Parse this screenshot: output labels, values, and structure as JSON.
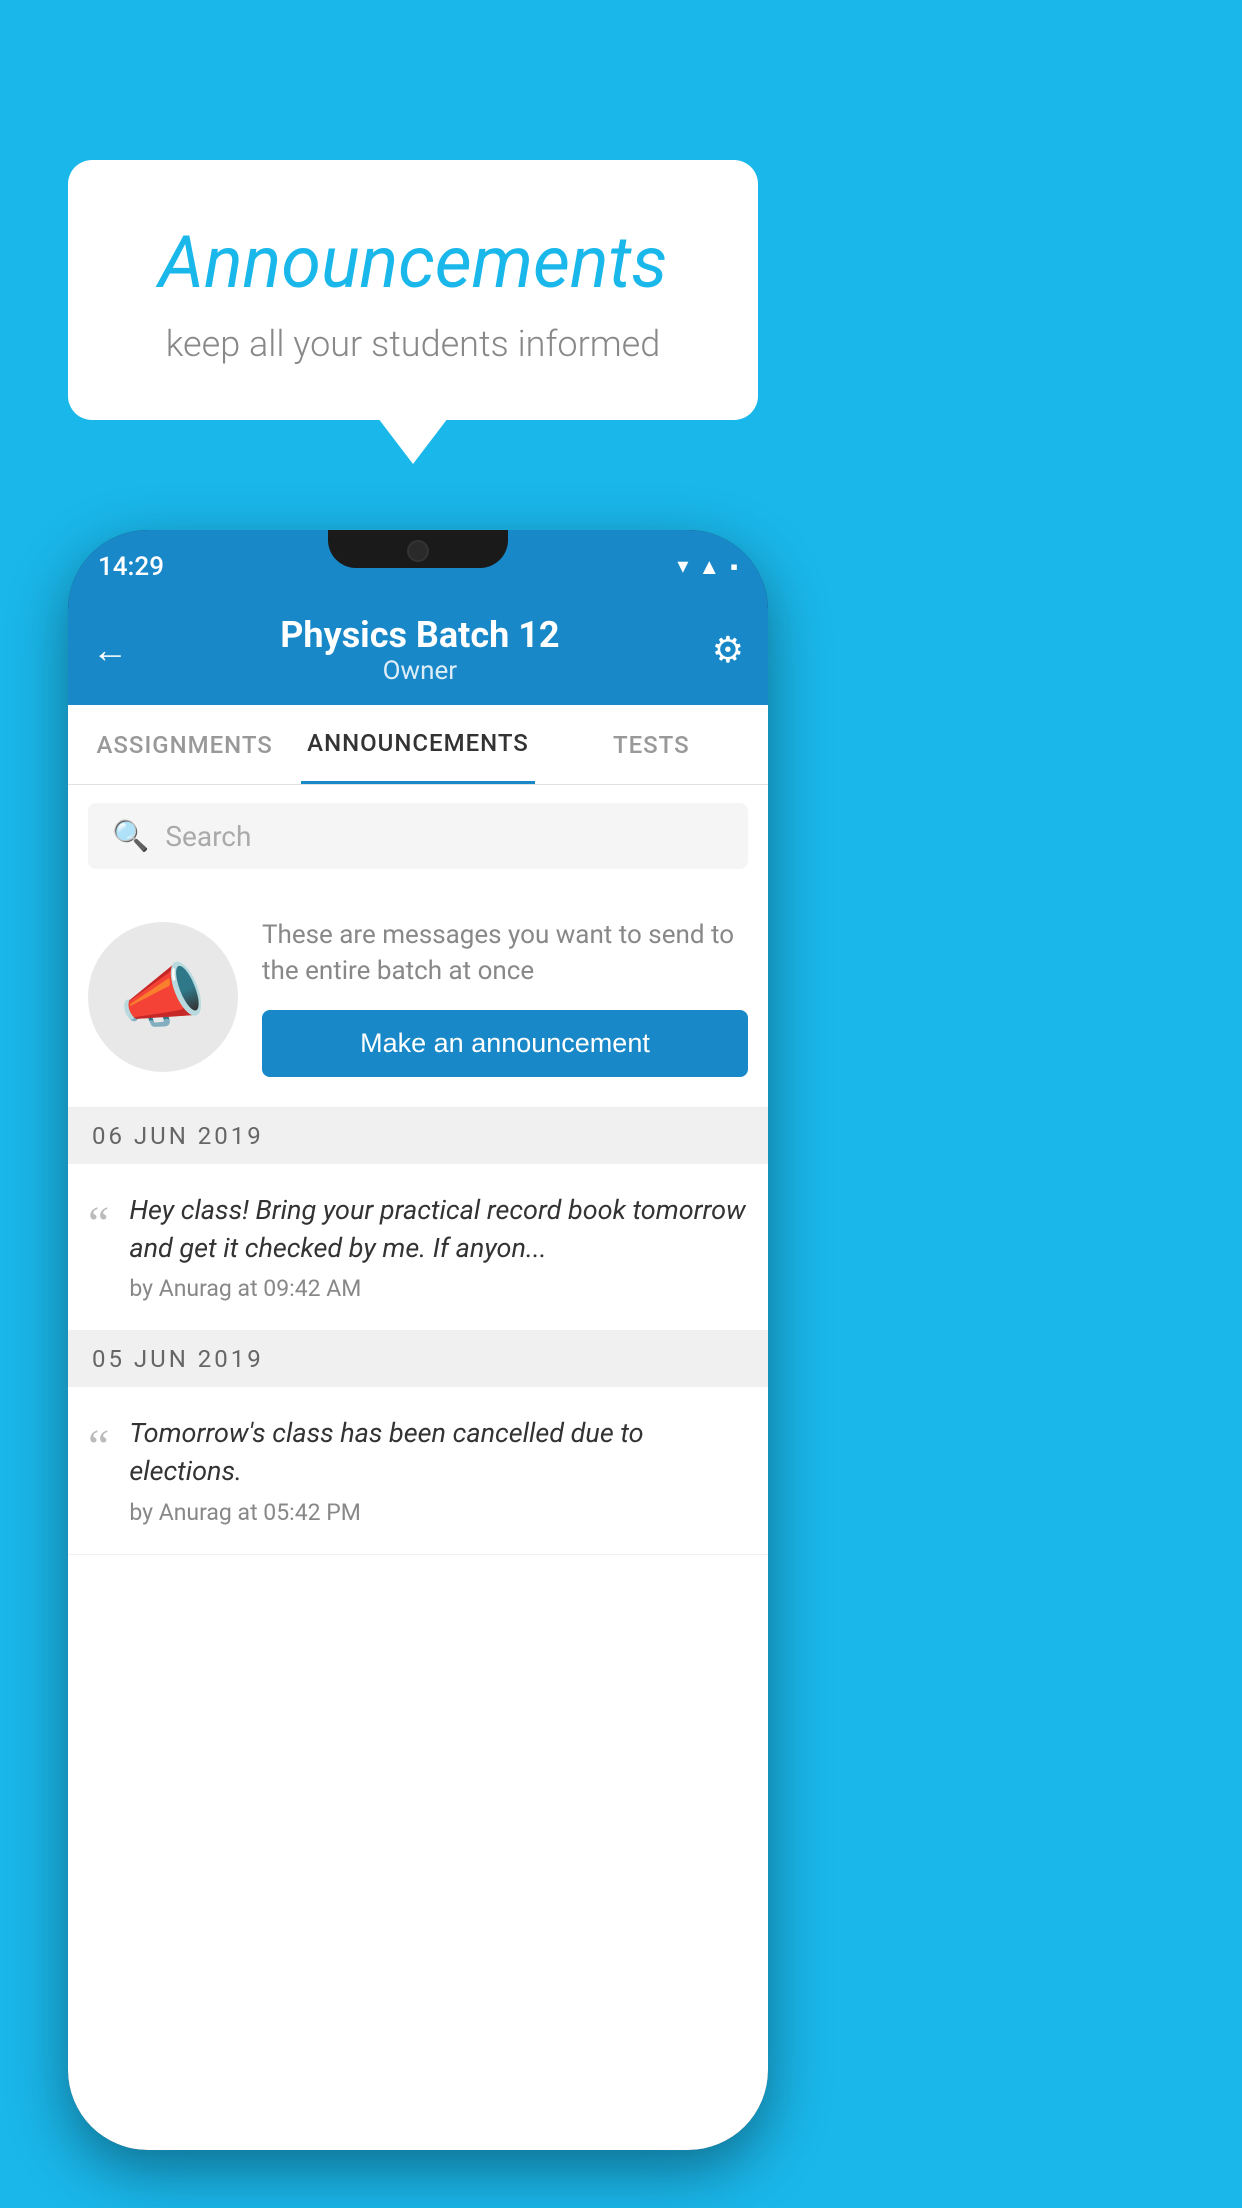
{
  "background_color": "#1ab7ea",
  "speech_bubble": {
    "title": "Announcements",
    "subtitle": "keep all your students informed"
  },
  "phone": {
    "status_bar": {
      "time": "14:29",
      "wifi_icon": "▾",
      "signal_icon": "▲",
      "battery_icon": "▪"
    },
    "app_bar": {
      "back_label": "←",
      "title": "Physics Batch 12",
      "subtitle": "Owner",
      "settings_icon": "⚙"
    },
    "tabs": [
      {
        "label": "ASSIGNMENTS",
        "active": false
      },
      {
        "label": "ANNOUNCEMENTS",
        "active": true
      },
      {
        "label": "TESTS",
        "active": false
      }
    ],
    "search": {
      "placeholder": "Search"
    },
    "empty_state": {
      "description": "These are messages you want to send to the entire batch at once",
      "button_label": "Make an announcement"
    },
    "announcements": [
      {
        "date": "06  JUN  2019",
        "text": "Hey class! Bring your practical record book tomorrow and get it checked by me. If anyon...",
        "meta": "by Anurag at 09:42 AM"
      },
      {
        "date": "05  JUN  2019",
        "text": "Tomorrow's class has been cancelled due to elections.",
        "meta": "by Anurag at 05:42 PM"
      }
    ]
  }
}
